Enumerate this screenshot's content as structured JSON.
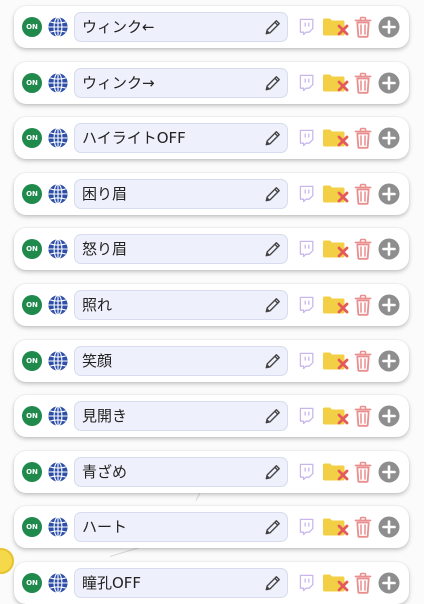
{
  "colors": {
    "on_green": "#1f8a4c",
    "globe_blue": "#2d4fa8",
    "twitch_purple": "#c9b6ef",
    "folder_yellow": "#f3cf45",
    "delete_red": "#e35a5a",
    "trash_red": "#ea8f8f",
    "plus_gray": "#8e8e8e"
  },
  "on_label": "ON",
  "icons": [
    "globe-icon",
    "pencil-icon",
    "twitch-icon",
    "folder-delete-icon",
    "trash-icon",
    "plus-icon"
  ],
  "items": [
    {
      "name": "ウィンク←"
    },
    {
      "name": "ウィンク→"
    },
    {
      "name": "ハイライトOFF"
    },
    {
      "name": "困り眉"
    },
    {
      "name": "怒り眉"
    },
    {
      "name": "照れ"
    },
    {
      "name": "笑顔"
    },
    {
      "name": "見開き"
    },
    {
      "name": "青ざめ"
    },
    {
      "name": "ハート"
    },
    {
      "name": "瞳孔OFF"
    }
  ]
}
